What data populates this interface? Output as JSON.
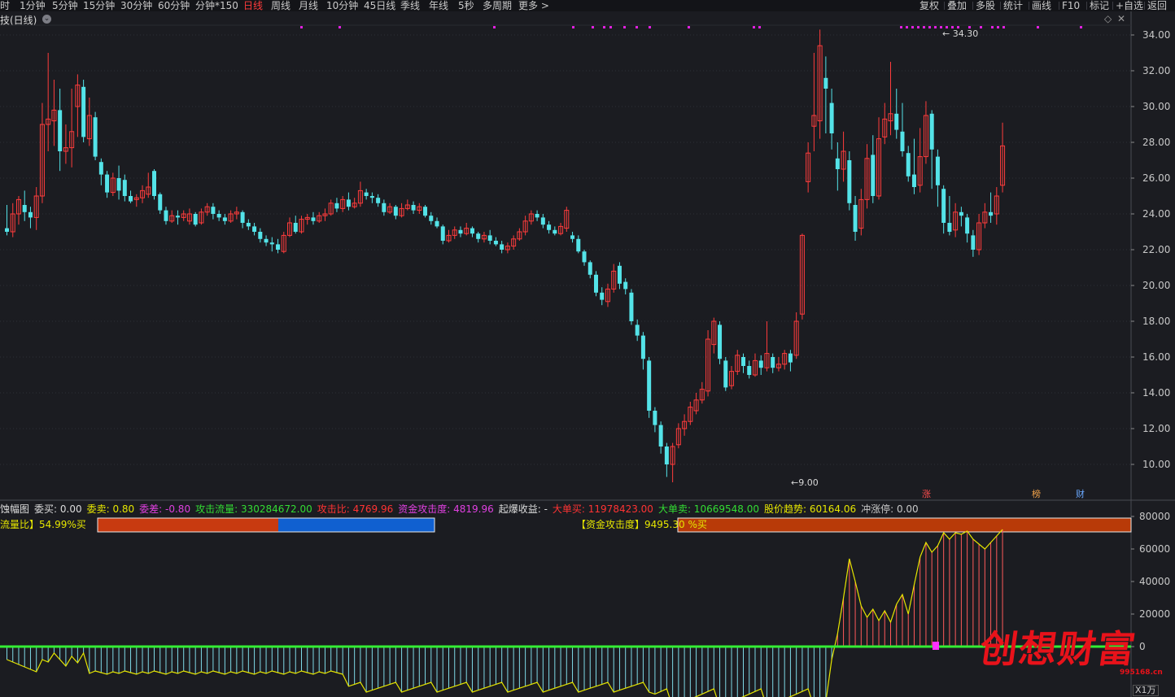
{
  "topbar": {
    "periods": [
      "时",
      "1分钟",
      "5分钟",
      "15分钟",
      "30分钟",
      "60分钟",
      "分钟*150",
      "日线",
      "周线",
      "月线",
      "10分钟",
      "45日线",
      "季线",
      "年线",
      "5秒",
      "多周期",
      "更多 >"
    ],
    "active_period": "日线",
    "tools": [
      "复权",
      "叠加",
      "多股",
      "统计",
      "画线",
      "F10",
      "标记",
      "+自选",
      "返回"
    ]
  },
  "chart_title": "技(日线)",
  "title_icon": "chevron-down-icon",
  "top_right_icons": [
    "diamond-icon",
    "close-icon"
  ],
  "price_axis": {
    "ticks": [
      "34.00",
      "32.00",
      "30.00",
      "28.00",
      "26.00",
      "24.00",
      "22.00",
      "20.00",
      "18.00",
      "16.00",
      "14.00",
      "12.00",
      "10.00"
    ],
    "high_label": "34.30",
    "low_label": "9.00"
  },
  "event_markers": [
    {
      "label": "涨",
      "color": "#ff4d4d"
    },
    {
      "label": "榜",
      "color": "#f2a24a"
    },
    {
      "label": "财",
      "color": "#6aa8ff"
    }
  ],
  "indicator_info": {
    "name": "蚀幅图",
    "items": [
      {
        "label": "委买: 0.00",
        "color": "#dcdcdc"
      },
      {
        "label": "委卖: 0.80",
        "color": "#e6e600"
      },
      {
        "label": "委差: -0.80",
        "color": "#e040e0"
      },
      {
        "label": "攻击流量: 330284672.00",
        "color": "#33dd33"
      },
      {
        "label": "攻击比: 4769.96",
        "color": "#ff3333"
      },
      {
        "label": "资金攻击度: 4819.96",
        "color": "#e040e0"
      },
      {
        "label": "起爆收益: -",
        "color": "#dcdcdc"
      },
      {
        "label": "大单买: 11978423.00",
        "color": "#ff3333"
      },
      {
        "label": "大单卖: 10669548.00",
        "color": "#33dd33"
      },
      {
        "label": "股价趋势: 60164.06",
        "color": "#e6e600"
      },
      {
        "label": "冲涨停: 0.00",
        "color": "#c8c8c8"
      }
    ]
  },
  "flow_ratio_label": "流量比】54.99%买",
  "attack_label": "【资金攻击度】9495.30 %买",
  "lower_axis": {
    "ticks": [
      "80000",
      "60000",
      "40000",
      "20000",
      "0"
    ],
    "unit": "X1万"
  },
  "watermark": {
    "text": "创想财富",
    "url": "995168.cn"
  },
  "colors": {
    "up": "#ff3c3c",
    "down": "#54e3e8",
    "background": "#1b1c21",
    "line": "#e6e600",
    "zero": "#33ee33"
  }
}
